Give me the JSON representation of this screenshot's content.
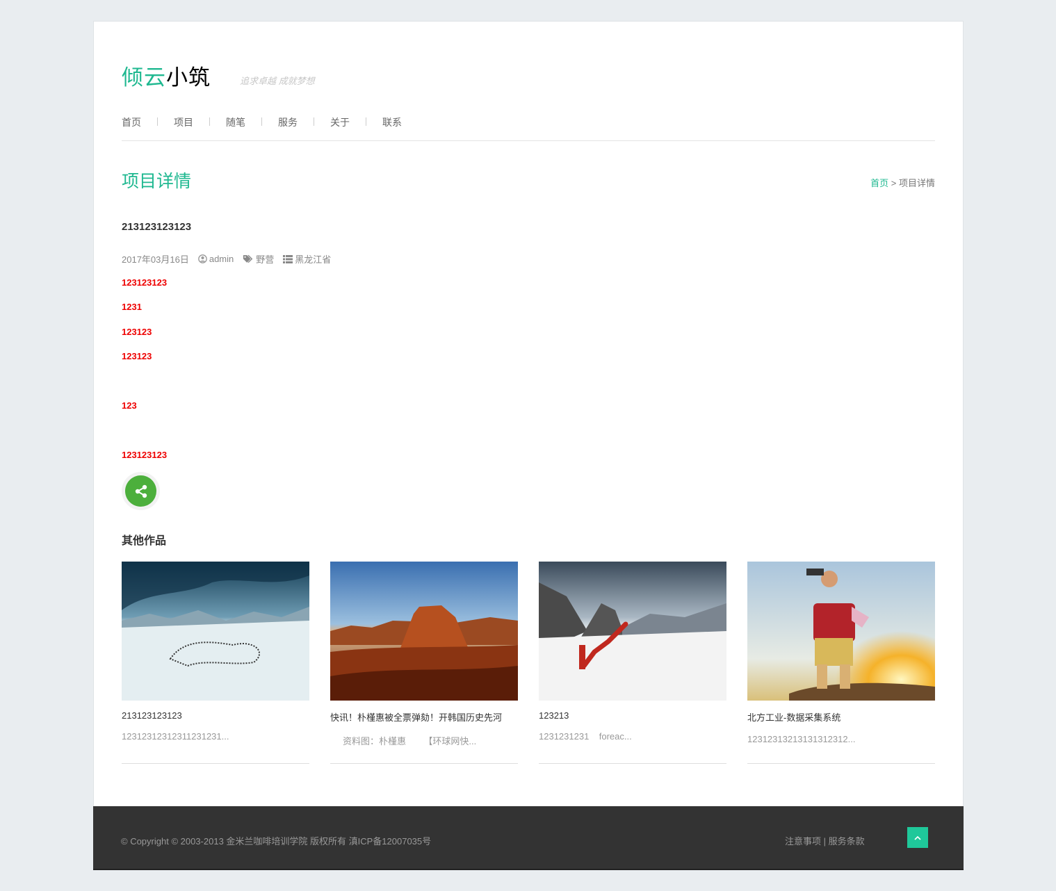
{
  "header": {
    "logo_part1": "倾云",
    "logo_part2": "小筑",
    "slogan": "追求卓越 成就梦想"
  },
  "nav": [
    "首页",
    "项目",
    "随笔",
    "服务",
    "关于",
    "联系"
  ],
  "page": {
    "title": "项目详情",
    "breadcrumb_home": "首页",
    "breadcrumb_sep": " > ",
    "breadcrumb_current": "项目详情"
  },
  "post": {
    "title": "213123123123",
    "date": "2017年03月16日",
    "author": "admin",
    "tag": "野营",
    "category": "黑龙江省",
    "lines": [
      "123123123",
      "1231",
      "123123",
      "123123",
      "123",
      "123123123"
    ]
  },
  "others": {
    "heading": "其他作品",
    "items": [
      {
        "title": "213123123123",
        "desc": "12312312312311231231..."
      },
      {
        "title": "快讯！朴槿惠被全票弹劾！开韩国历史先河",
        "desc": "     资料图：朴槿惠       【环球网快..."
      },
      {
        "title": "123213",
        "desc": "1231231231    foreac..."
      },
      {
        "title": "北方工业-数据采集系统",
        "desc": "12312313213131312312..."
      }
    ]
  },
  "footer": {
    "copyright": "© Copyright © 2003-2013 金米兰咖啡培训学院 版权所有 滇ICP备12007035号",
    "link1": "注意事项",
    "link_sep": " | ",
    "link2": "服务条款"
  },
  "colors": {
    "accent": "#1fb890",
    "red": "#ee0000",
    "share": "#4caf3c",
    "footer": "#333333"
  }
}
